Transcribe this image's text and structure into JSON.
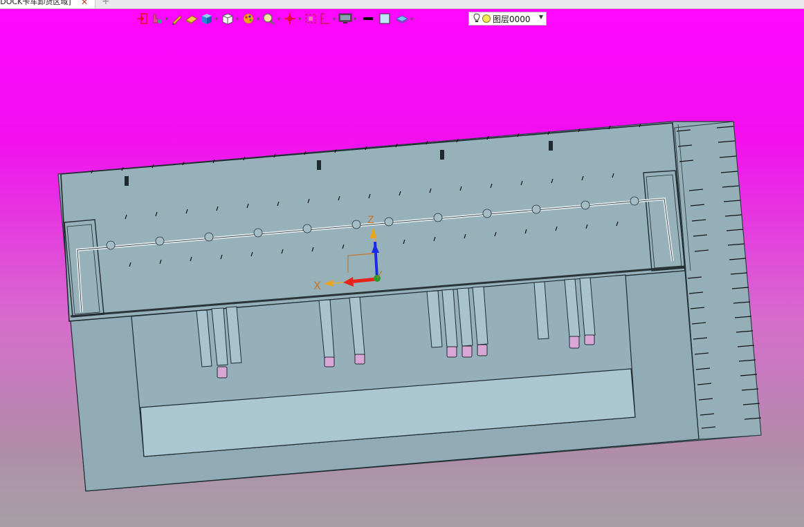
{
  "tab": {
    "title": "[DOCK卡车卸货区域]",
    "close": "✕",
    "new": "+"
  },
  "toolbar": {
    "layer_label": "图层0000",
    "icons": [
      "exit-icon",
      "grab-icon",
      "pencil-icon",
      "eraser-icon",
      "solid-cube-icon",
      "wire-cube-icon",
      "color-wheel-icon",
      "zoom-icon",
      "pan-icon",
      "fit-view-icon",
      "measure-icon",
      "display-monitor-icon",
      "line-weight-icon",
      "fill-color-icon",
      "layers-icon"
    ]
  },
  "axes": {
    "x_label": "X",
    "z_label": "Z"
  },
  "colors": {
    "x_axis": "#e8231b",
    "z_axis": "#1b2ce8",
    "y_axis": "#2a9a2a",
    "background_top": "#ff07ff",
    "model_fill": "#93aeb8",
    "pit_fill": "#a9c6d1"
  }
}
